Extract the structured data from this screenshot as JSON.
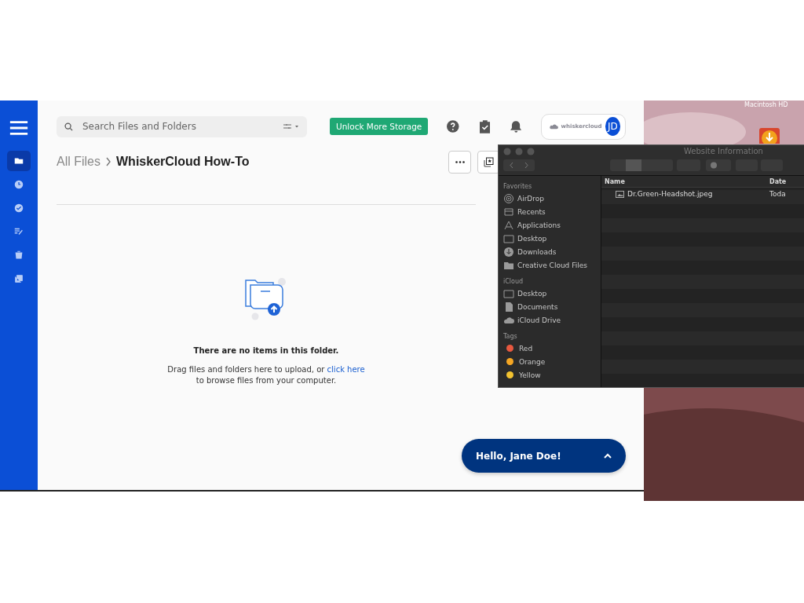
{
  "app": {
    "nav_items": [
      {
        "kind": "folder",
        "selected": true
      },
      {
        "kind": "clock",
        "selected": false
      },
      {
        "kind": "check",
        "selected": false
      },
      {
        "kind": "edit",
        "selected": false
      },
      {
        "kind": "trash",
        "selected": false
      },
      {
        "kind": "copy",
        "selected": false
      }
    ],
    "search": {
      "placeholder": "Search Files and Folders"
    },
    "upgrade_button": "Unlock More Storage",
    "brand": {
      "logo_text": "whiskercloud",
      "avatar": "JD"
    },
    "breadcrumb": [
      {
        "label": "All Files",
        "current": false
      },
      {
        "label": "WhiskerCloud How-To",
        "current": true
      }
    ],
    "empty_state": {
      "title": "There are no items in this folder.",
      "text_before": "Drag files and folders here to upload, or ",
      "link": "click here",
      "text_after": " to browse files from your computer."
    },
    "chat_bar": {
      "greeting": "Hello, Jane Doe!"
    }
  },
  "desktop": {
    "drive_label": "Macintosh HD"
  },
  "finder": {
    "title": "Website Information",
    "sidebar": [
      {
        "heading": "Favorites",
        "items": [
          {
            "label": "AirDrop",
            "kind": "airdrop"
          },
          {
            "label": "Recents",
            "kind": "recents"
          },
          {
            "label": "Applications",
            "kind": "apps"
          },
          {
            "label": "Desktop",
            "kind": "desktop"
          },
          {
            "label": "Downloads",
            "kind": "downloads"
          },
          {
            "label": "Creative Cloud Files",
            "kind": "folder"
          }
        ]
      },
      {
        "heading": "iCloud",
        "items": [
          {
            "label": "Desktop",
            "kind": "desktop"
          },
          {
            "label": "Documents",
            "kind": "documents"
          },
          {
            "label": "iCloud Drive",
            "kind": "cloud"
          }
        ]
      },
      {
        "heading": "Tags",
        "items": [
          {
            "label": "Red",
            "kind": "tag",
            "color": "#e8583f"
          },
          {
            "label": "Orange",
            "kind": "tag",
            "color": "#f5a623"
          },
          {
            "label": "Yellow",
            "kind": "tag",
            "color": "#f2c230"
          }
        ]
      }
    ],
    "columns": [
      "Name",
      "Date"
    ],
    "files": [
      {
        "name": "Dr.Green-Headshot.jpeg",
        "date": "Toda"
      }
    ]
  }
}
